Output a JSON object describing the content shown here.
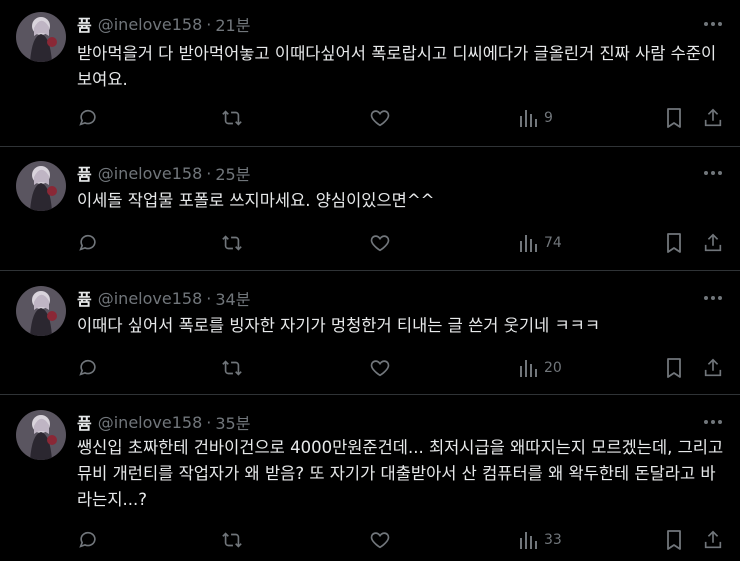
{
  "tweets": [
    {
      "name": "퓸",
      "handle": "@inelove158",
      "separator": "·",
      "time": "21분",
      "text": "받아먹을거 다 받아먹어놓고 이때다싶어서 폭로랍시고 디씨에다가 글올린거 진짜 사람 수준이 보여요.",
      "views": "9"
    },
    {
      "name": "퓸",
      "handle": "@inelove158",
      "separator": "·",
      "time": "25분",
      "text": "이세돌 작업물 포폴로 쓰지마세요. 양심이있으면^^",
      "views": "74"
    },
    {
      "name": "퓸",
      "handle": "@inelove158",
      "separator": "·",
      "time": "34분",
      "text": "이때다 싶어서 폭로를 빙자한 자기가 멍청한거 티내는 글 쓴거 웃기네 ㅋㅋㅋ",
      "views": "20"
    },
    {
      "name": "퓸",
      "handle": "@inelove158",
      "separator": "·",
      "time": "35분",
      "text": "쌩신입 초짜한테 건바이건으로 4000만원준건데... 최저시급을 왜따지는지 모르겠는데, 그리고  뮤비 개런티를 작업자가 왜 받음? 또 자기가 대출받아서 산 컴퓨터를 왜 왁두한테 돈달라고 바라는지...?",
      "views": "33"
    }
  ],
  "icons": {
    "more": "more-horizontal-icon",
    "reply": "reply-icon",
    "retweet": "retweet-icon",
    "like": "heart-icon",
    "views": "views-bar-chart-icon",
    "bookmark": "bookmark-icon",
    "share": "share-icon"
  },
  "colors": {
    "background": "#000000",
    "text": "#e7e9ea",
    "muted": "#71767b",
    "divider": "#2f3336"
  }
}
